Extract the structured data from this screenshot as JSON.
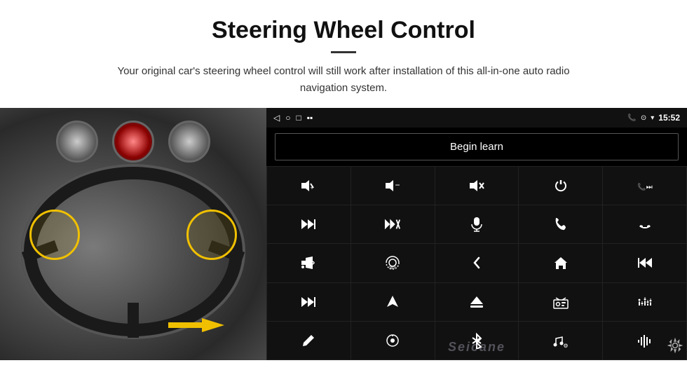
{
  "header": {
    "title": "Steering Wheel Control",
    "subtitle": "Your original car's steering wheel control will still work after installation of this all-in-one auto radio navigation system."
  },
  "status_bar": {
    "nav_back": "◁",
    "nav_home_circle": "○",
    "nav_square": "□",
    "nav_battery": "▪▪",
    "phone_icon": "📞",
    "location_icon": "⊙",
    "wifi_icon": "▾",
    "time": "15:52"
  },
  "begin_learn": {
    "label": "Begin learn"
  },
  "watermark": {
    "text": "Seicane"
  },
  "icons": [
    {
      "symbol": "🔊+",
      "label": "vol-up"
    },
    {
      "symbol": "🔊−",
      "label": "vol-down"
    },
    {
      "symbol": "🔇",
      "label": "mute"
    },
    {
      "symbol": "⏻",
      "label": "power"
    },
    {
      "symbol": "⏭",
      "label": "skip-forward"
    },
    {
      "symbol": "⏭",
      "label": "next"
    },
    {
      "symbol": "⏭✕",
      "label": "skip-cross"
    },
    {
      "symbol": "🎤",
      "label": "mic"
    },
    {
      "symbol": "📞",
      "label": "phone"
    },
    {
      "symbol": "📞↩",
      "label": "hang-up"
    },
    {
      "symbol": "📣",
      "label": "horn"
    },
    {
      "symbol": "360°",
      "label": "camera-360"
    },
    {
      "symbol": "↩",
      "label": "back"
    },
    {
      "symbol": "🏠",
      "label": "home"
    },
    {
      "symbol": "⏮",
      "label": "prev"
    },
    {
      "symbol": "⏭",
      "label": "fast-forward"
    },
    {
      "symbol": "▶",
      "label": "nav"
    },
    {
      "symbol": "⏺",
      "label": "eject"
    },
    {
      "symbol": "📻",
      "label": "radio"
    },
    {
      "symbol": "⚙⚙",
      "label": "settings-eq"
    },
    {
      "symbol": "✏",
      "label": "pen"
    },
    {
      "symbol": "⊙",
      "label": "knob"
    },
    {
      "symbol": "✶",
      "label": "bluetooth"
    },
    {
      "symbol": "♫⚙",
      "label": "music-settings"
    },
    {
      "symbol": "📊",
      "label": "equalizer"
    }
  ]
}
